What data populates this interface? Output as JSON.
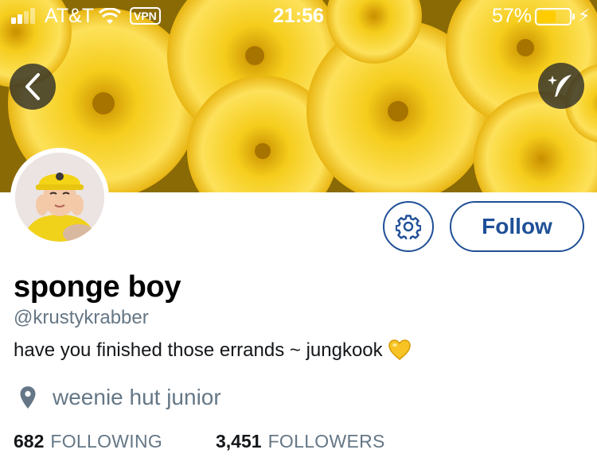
{
  "status_bar": {
    "carrier": "AT&T",
    "vpn": "VPN",
    "time": "21:56",
    "battery_percent": "57%",
    "battery_level": 0.57
  },
  "header": {
    "banner_icon": "yellow-flowers-photo",
    "back_icon": "chevron-left-icon",
    "magic_icon": "sparkle-feather-icon"
  },
  "profile": {
    "display_name": "sponge boy",
    "handle": "@krustykrabber",
    "bio": "have you finished those errands ~ jungkook",
    "bio_emoji": "yellow-heart",
    "location": "weenie hut junior",
    "following_count": "682",
    "following_label": "FOLLOWING",
    "followers_count": "3,451",
    "followers_label": "FOLLOWERS"
  },
  "actions": {
    "settings_icon": "gear-icon",
    "follow_label": "Follow"
  },
  "colors": {
    "accent": "#1f4f97",
    "muted_text": "#657786",
    "banner_yellow": "#f2c21b",
    "battery_fill": "#ffcc00"
  }
}
